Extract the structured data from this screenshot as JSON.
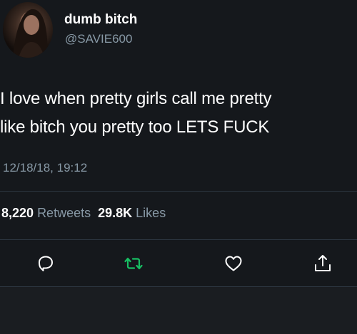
{
  "user": {
    "display_name": "dumb bitch",
    "handle": "@SAVIE600"
  },
  "tweet": {
    "lines": [
      "I love when pretty girls call me pretty",
      "like bitch you pretty too LETS FUCK"
    ],
    "timestamp": "12/18/18, 19:12"
  },
  "stats": {
    "retweets_count": "8,220",
    "retweets_label": "Retweets",
    "likes_count": "29.8K",
    "likes_label": "Likes"
  },
  "actions": {
    "reply_icon": "reply-icon",
    "retweet_icon": "retweet-icon",
    "like_icon": "heart-icon",
    "share_icon": "share-icon"
  },
  "colors": {
    "background": "#15181c",
    "text_primary": "#ffffff",
    "text_secondary": "#8899a6",
    "retweet_green": "#17bf63",
    "icon_gray": "#ffffff"
  }
}
